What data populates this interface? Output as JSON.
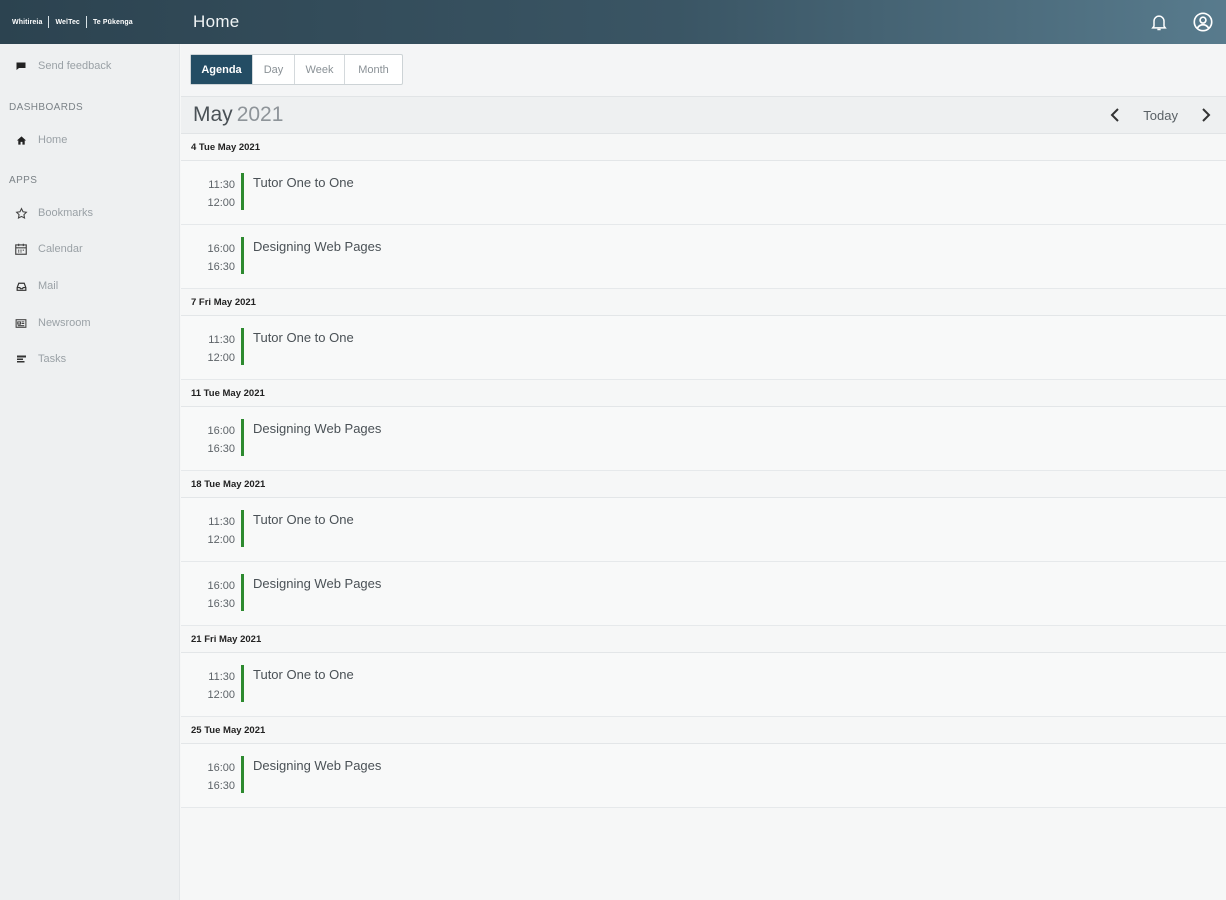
{
  "header": {
    "logos": [
      "Whitireia",
      "WelTec",
      "Te Pūkenga"
    ],
    "title": "Home"
  },
  "sidebar": {
    "feedback": "Send feedback",
    "dashboards_heading": "DASHBOARDS",
    "home": "Home",
    "apps_heading": "APPS",
    "apps": [
      "Bookmarks",
      "Calendar",
      "Mail",
      "Newsroom",
      "Tasks"
    ]
  },
  "toolbar": {
    "tabs": [
      "Agenda",
      "Day",
      "Week",
      "Month"
    ],
    "active_tab": "Agenda"
  },
  "calendar": {
    "month": "May",
    "year": "2021",
    "today_label": "Today"
  },
  "agenda": [
    {
      "date": "4 Tue May 2021",
      "events": [
        {
          "start": "11:30",
          "end": "12:00",
          "title": "Tutor One to One"
        },
        {
          "start": "16:00",
          "end": "16:30",
          "title": "Designing Web Pages"
        }
      ]
    },
    {
      "date": "7 Fri May 2021",
      "events": [
        {
          "start": "11:30",
          "end": "12:00",
          "title": "Tutor One to One"
        }
      ]
    },
    {
      "date": "11 Tue May 2021",
      "events": [
        {
          "start": "16:00",
          "end": "16:30",
          "title": "Designing Web Pages"
        }
      ]
    },
    {
      "date": "18 Tue May 2021",
      "events": [
        {
          "start": "11:30",
          "end": "12:00",
          "title": "Tutor One to One"
        },
        {
          "start": "16:00",
          "end": "16:30",
          "title": "Designing Web Pages"
        }
      ]
    },
    {
      "date": "21 Fri May 2021",
      "events": [
        {
          "start": "11:30",
          "end": "12:00",
          "title": "Tutor One to One"
        }
      ]
    },
    {
      "date": "25 Tue May 2021",
      "events": [
        {
          "start": "16:00",
          "end": "16:30",
          "title": "Designing Web Pages"
        }
      ]
    }
  ],
  "colors": {
    "event_bar": "#2d8a2f",
    "active_tab": "#244d64"
  }
}
